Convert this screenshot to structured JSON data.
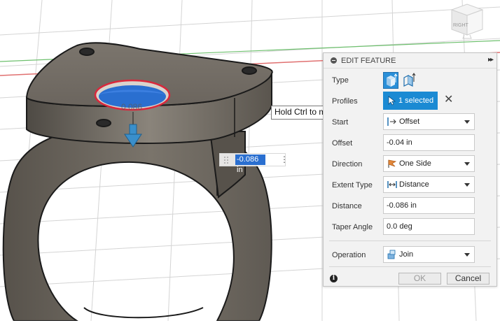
{
  "panel": {
    "title": "EDIT FEATURE",
    "expand_glyph": "▸▸",
    "rows": {
      "type": {
        "label": "Type"
      },
      "profiles": {
        "label": "Profiles",
        "value": "1 selected",
        "clear_glyph": "✕"
      },
      "start": {
        "label": "Start",
        "value": "Offset"
      },
      "offset": {
        "label": "Offset",
        "value": "-0.04 in"
      },
      "direction": {
        "label": "Direction",
        "value": "One Side"
      },
      "extent_type": {
        "label": "Extent Type",
        "value": "Distance"
      },
      "distance": {
        "label": "Distance",
        "value": "-0.086 in"
      },
      "taper_angle": {
        "label": "Taper Angle",
        "value": "0.0 deg"
      },
      "operation": {
        "label": "Operation",
        "value": "Join"
      }
    },
    "ok_label": "OK",
    "cancel_label": "Cancel",
    "info_glyph": "i"
  },
  "tooltip": {
    "text": "Hold Ctrl to modify selection"
  },
  "dimension_input": {
    "value": "-0.086 in",
    "menu_glyph": "⋮"
  },
  "dimension_ghost_label": "0.086",
  "viewcube": {
    "face_label": "RIGHT"
  },
  "icons": {
    "header": "minus-circle-icon",
    "type_1": "extrude-solid-icon",
    "type_2": "extrude-surface-icon",
    "profiles": "cursor-select-icon",
    "start": "start-offset-icon",
    "direction": "one-side-direction-icon",
    "extent": "distance-extent-icon",
    "operation": "join-operation-icon",
    "info": "info-icon"
  },
  "colors": {
    "accent": "#1b8ad3",
    "model": "#6e6860",
    "selection_fill": "#2a6fd0",
    "selection_edge": "#d9283c",
    "arrow": "#3a8fcb",
    "grid_red": "#e07070",
    "grid_green": "#6ec06e"
  }
}
